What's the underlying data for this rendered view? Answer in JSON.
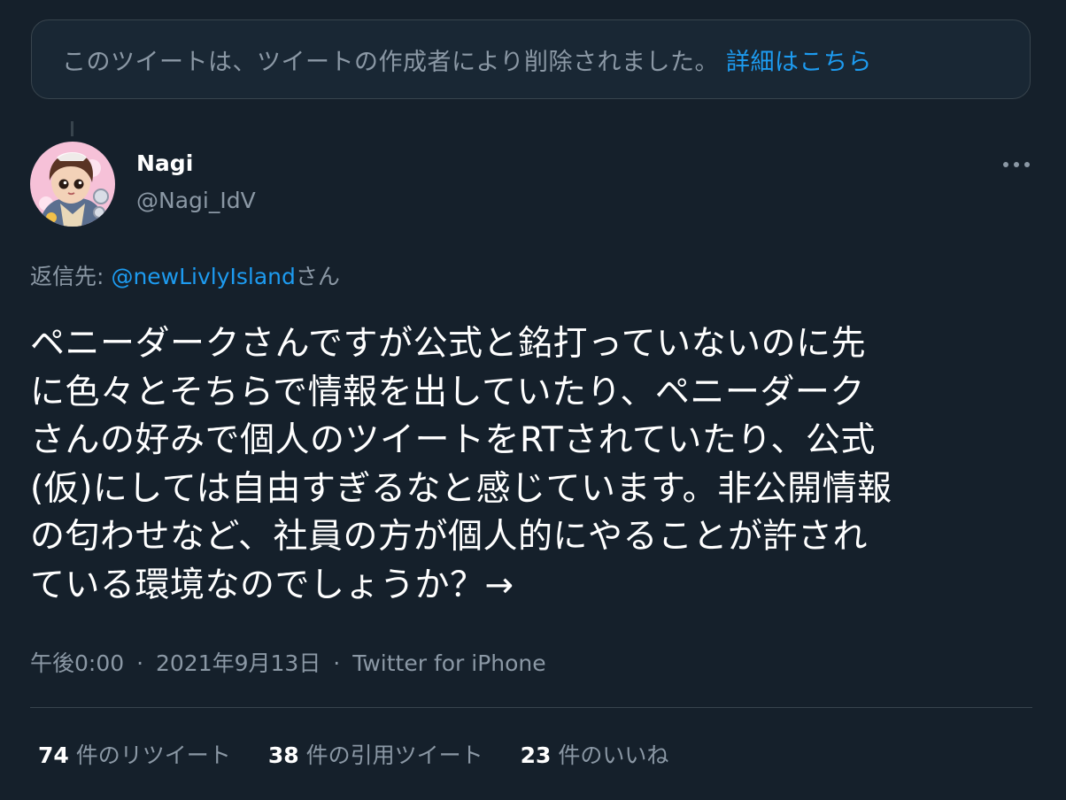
{
  "notice": {
    "text": "このツイートは、ツイートの作成者により削除されました。",
    "link_label": "詳細はこちら"
  },
  "author": {
    "name": "Nagi",
    "handle": "@Nagi_IdV"
  },
  "reply": {
    "prefix": "返信先:",
    "mention": "@newLivlyIsland",
    "suffix": "さん"
  },
  "tweet": {
    "text": "ペニーダークさんですが公式と銘打っていないのに先\nに色々とそちらで情報を出していたり、ペニーダーク\nさんの好みで個人のツイートをRTされていたり、公式\n(仮)にしては自由すぎるなと感じています。非公開情報\nの匂わせなど、社員の方が個人的にやることが許され\nている環境なのでしょうか？→"
  },
  "meta": {
    "time": "午後0:00",
    "separator": "·",
    "date": "2021年9月13日",
    "source": "Twitter for iPhone"
  },
  "stats": {
    "retweets_count": "74",
    "retweets_label": "件のリツイート",
    "quotes_count": "38",
    "quotes_label": "件の引用ツイート",
    "likes_count": "23",
    "likes_label": "件のいいね"
  },
  "icons": {
    "more": "more-horizontal-icon",
    "avatar": "user-avatar-illustration"
  },
  "colors": {
    "background": "#15202b",
    "accent": "#1d9bf0",
    "muted": "#8b98a5",
    "border": "#38444d"
  }
}
